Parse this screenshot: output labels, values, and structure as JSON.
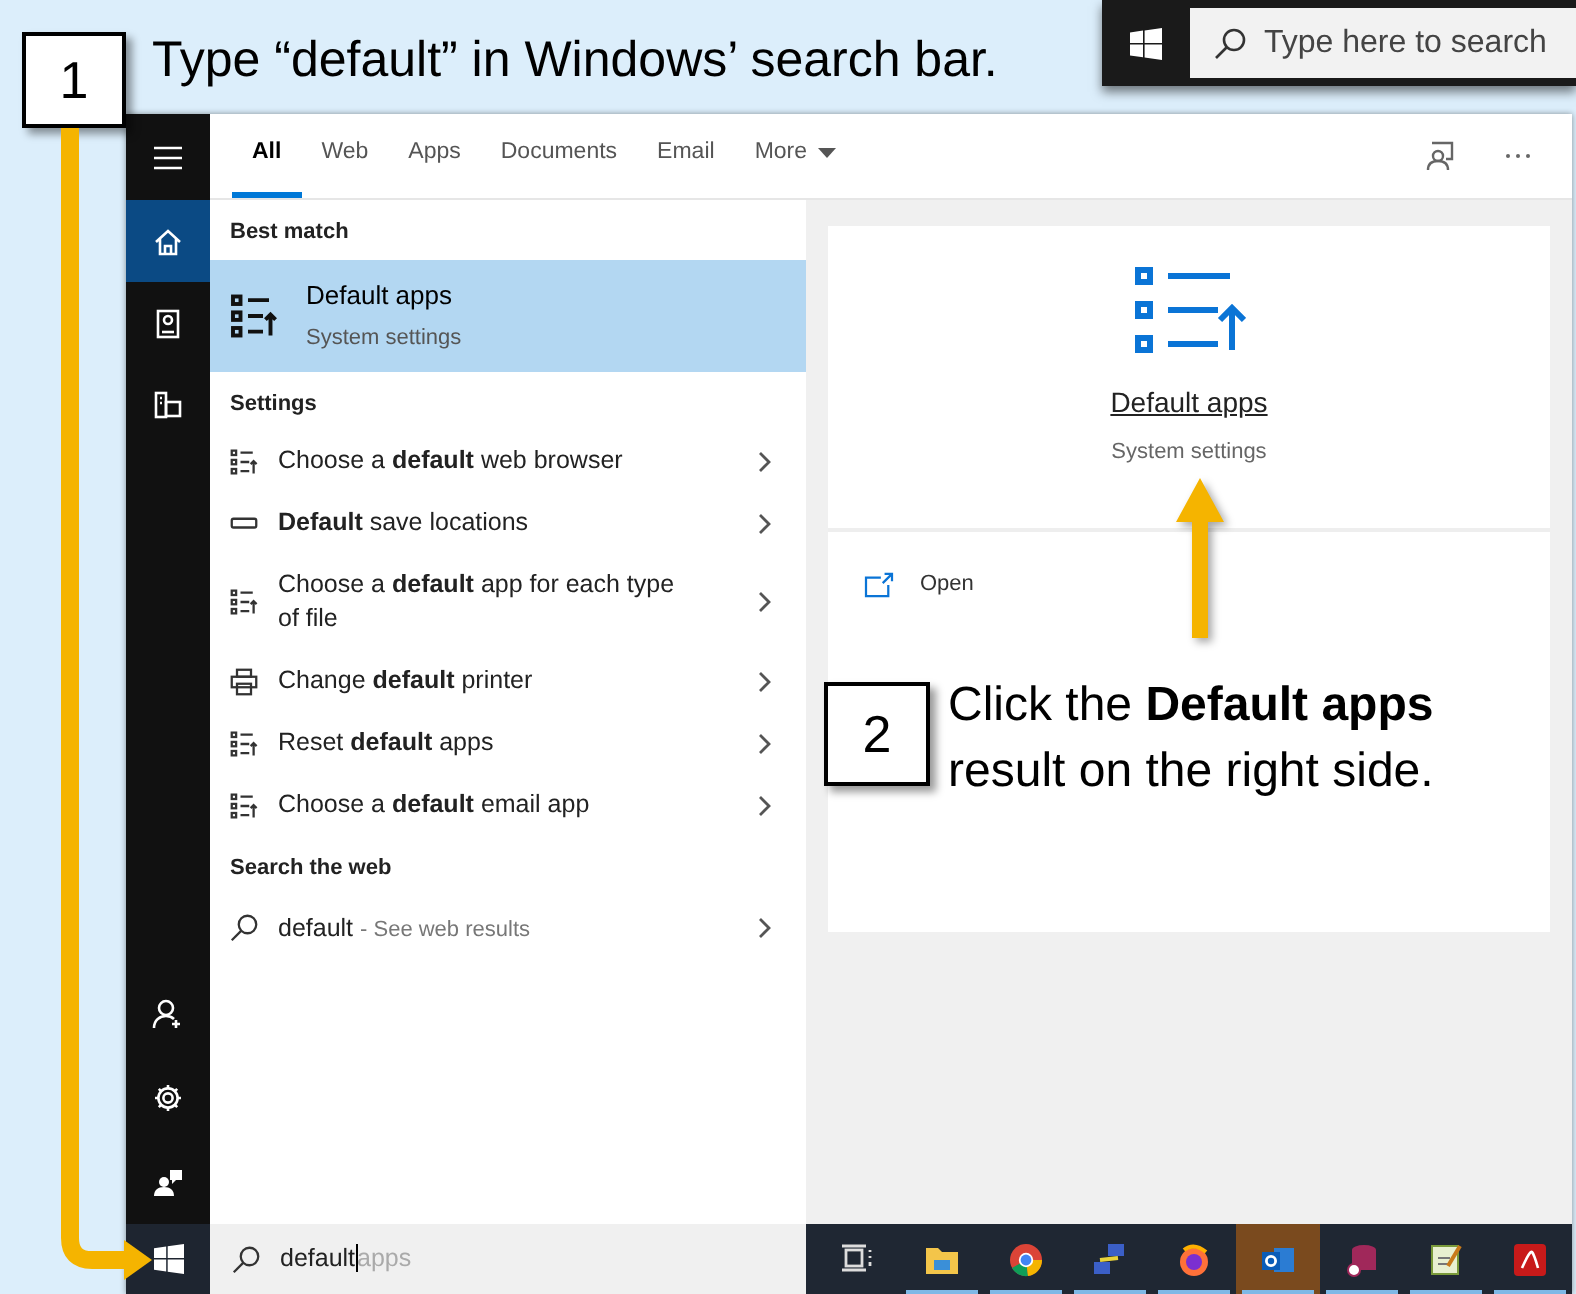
{
  "callouts": [
    {
      "number": "1",
      "text": "Type “default” in Windows’ search bar."
    },
    {
      "number": "2",
      "text": "Click the **Default apps** result on the right side."
    }
  ],
  "taskbar_snippet": {
    "search_placeholder": "Type here to search"
  },
  "tabs": [
    {
      "label": "All",
      "selected": true,
      "kind": "tab"
    },
    {
      "label": "Web",
      "selected": false,
      "kind": "tab"
    },
    {
      "label": "Apps",
      "selected": false,
      "kind": "tab"
    },
    {
      "label": "Documents",
      "selected": false,
      "kind": "tab"
    },
    {
      "label": "Email",
      "selected": false,
      "kind": "tab"
    },
    {
      "label": "More",
      "selected": false,
      "kind": "dropdown"
    }
  ],
  "sidebar": {
    "items": [
      {
        "selected": true
      },
      {
        "selected": false
      },
      {
        "selected": false
      }
    ]
  },
  "sections": [
    {
      "title": "Best match",
      "items": [
        {
          "kind": "best",
          "title": "Default apps",
          "subtitle": "System settings",
          "selected": true
        }
      ]
    },
    {
      "title": "Settings",
      "items": [
        {
          "kind": "setting",
          "text": "Choose a **default** web browser",
          "selected": false
        },
        {
          "kind": "setting",
          "text": "**Default** save locations",
          "selected": false
        },
        {
          "kind": "setting",
          "text": "Choose a **default** app for each type of file",
          "selected": false
        },
        {
          "kind": "setting",
          "text": "Change **default** printer",
          "selected": false
        },
        {
          "kind": "setting",
          "text": "Reset **default** apps",
          "selected": false
        },
        {
          "kind": "setting",
          "text": "Choose a **default** email app",
          "selected": false
        }
      ]
    },
    {
      "title": "Search the web",
      "items": [
        {
          "kind": "web",
          "text": "default",
          "hint": "- See web results",
          "selected": false
        }
      ]
    }
  ],
  "preview": {
    "title": "Default apps",
    "subtitle": "System settings",
    "actions": [
      {
        "label": "Open"
      }
    ]
  },
  "search": {
    "value": "default",
    "suggestion": "apps"
  },
  "taskbar": {
    "apps": [
      {
        "selected": false,
        "running": false
      },
      {
        "selected": false,
        "running": true
      },
      {
        "selected": false,
        "running": true
      },
      {
        "selected": false,
        "running": true
      },
      {
        "selected": false,
        "running": true
      },
      {
        "selected": true,
        "running": true
      },
      {
        "selected": false,
        "running": true
      },
      {
        "selected": false,
        "running": true
      },
      {
        "selected": false,
        "running": true
      }
    ]
  }
}
